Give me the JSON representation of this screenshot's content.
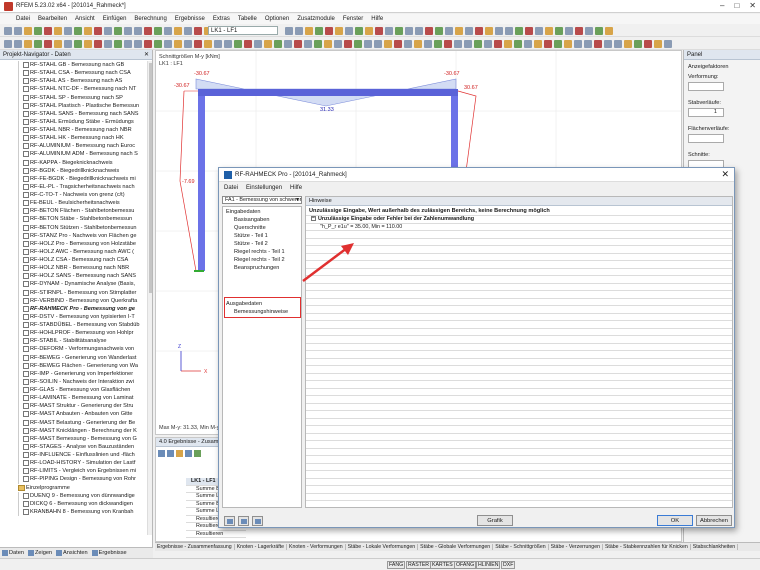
{
  "window": {
    "title": "RFEM 5.23.02 x64 - [201014_Rahmeck*]",
    "controls": [
      "–",
      "□",
      "✕"
    ]
  },
  "menu": [
    "Datei",
    "Bearbeiten",
    "Ansicht",
    "Einfügen",
    "Berechnung",
    "Ergebnisse",
    "Extras",
    "Tabelle",
    "Optionen",
    "Zusatzmodule",
    "Fenster",
    "Hilfe"
  ],
  "toolbar": {
    "load_case": "LK1 - LF1"
  },
  "navigator": {
    "title": "Projekt-Navigator - Daten",
    "items": [
      "RF-STAHL GB - Bemessung nach GB",
      "RF-STAHL CSA - Bemessung nach CSA",
      "RF-STAHL AS - Bemessung nach AS",
      "RF-STAHL NTC-DF - Bemessung nach NT",
      "RF-STAHL SP - Bemessung nach SP",
      "RF-STAHL Plastisch - Plastische Bemessun",
      "RF-STAHL SANS - Bemessung nach SANS",
      "RF-STAHL Ermüdung Stäbe - Ermüdungs",
      "RF-STAHL NBR - Bemessung nach NBR",
      "RF-STAHL HK - Bemessung nach HK",
      "RF-ALUMINIUM - Bemessung nach Euroc",
      "RF-ALUMINIUM ADM - Bemessung nach S",
      "RF-KAPPA - Biegeknicknachweis",
      "RF-BGDK - Biegedrillknicknachweis",
      "RF-FE-BGDK - Biegedrillknicknachweis mi",
      "RF-EL-PL - Tragsicherheitsnachweis nach",
      "RF-C-TO-T - Nachweis von grenz (c/t)",
      "FE-BEUL - Beulsicherheitsnachweis",
      "RF-BETON Flächen - Stahlbetonbemessu",
      "RF-BETON Stäbe - Stahlbetonbemessun",
      "RF-BETON Stützen - Stahlbetonbemessun",
      "RF-STANZ Pro - Nachweis von Flächen ge",
      "RF-HOLZ Pro - Bemessung von Holzstäbe",
      "RF-HOLZ AWC - Bemessung nach AWC (",
      "RF-HOLZ CSA - Bemessung nach CSA",
      "RF-HOLZ NBR - Bemessung nach NBR",
      "RF-HOLZ SANS - Bemessung nach SANS",
      "RF-DYNAM - Dynamische Analyse (Basis,",
      "RF-STIRNPL - Bemessung von Stirnplatter",
      "RF-VERBIND - Bemessung von Querkrafta",
      "RF-RAHMECK Pro - Bemessung von ge",
      "RF-DSTV - Bemessung von typisierten I-T",
      "RF-STABDÜBEL - Bemessung von Stabdüb",
      "RF-HOHLPROF - Bemessung von Hohlpr",
      "RF-STABIL - Stabilitätsanalyse",
      "RF-DEFORM - Verformungsnachweis von",
      "RF-BEWEG - Generierung von Wanderlast",
      "RF-BEWEG Flächen - Generierung von Wa",
      "RF-IMP - Generierung von Imperfektioner",
      "RF-SOILIN - Nachweis der Interaktion zwi",
      "RF-GLAS - Bemessung von Glasflächen",
      "RF-LAMINATE - Bemessung von Laminat",
      "RF-MAST Struktur - Generierung der Stru",
      "RF-MAST Anbauten - Anbauten von Gitte",
      "RF-MAST Belastung - Generierung der Be",
      "RF-MAST Knicklängen - Berechnung der K",
      "RF-MAST Bemessung - Bemessung von G",
      "RF-STAGES - Analyse von Bauzuständen",
      "RF-INFLUENCE - Einflusslinien und -fläch",
      "RF-LOAD-HISTORY - Simulation der Lastf",
      "RF-LIMITS - Vergleich von Ergebnissen mi",
      "RF-PIPING Design - Bemessung von Rohr"
    ],
    "category": "Einzelprogramme",
    "sub_items": [
      "DUENQ 9 - Bemessung von dünnwandige",
      "DICKQ 6 - Bemessung von dickwandigen",
      "KRANBAHN 8 - Bemessung von Kranbah"
    ],
    "tabs": [
      "Daten",
      "Zeigen",
      "Ansichten",
      "Ergebnisse"
    ]
  },
  "viewport": {
    "title": "Schnittgrößen M-y [kNm]",
    "subtitle": "LK1 : LF1",
    "values": [
      "-30.67",
      "-30.67",
      "-30.67",
      "30.67",
      "31.33",
      "-7.69"
    ],
    "footer": "Max M-y: 31.33, Min M-y:"
  },
  "right_panel": {
    "title": "Panel",
    "labels": [
      "Anzeigefaktoren",
      "Verformung:",
      "Stabverläufe:",
      "Flächenverläufe:",
      "Schnitte:"
    ],
    "stab_value": "1"
  },
  "results": {
    "title": "4.0 Ergebnisse - Zusamm",
    "lk": "LK1 - LF1",
    "rows": [
      "Summe Bela",
      "Summe Lage",
      "Summe Bela",
      "Summe Lage",
      "Resultieren",
      "Resultieren",
      "Resultieren"
    ],
    "tabs": [
      "Ergebnisse - Zusammenfassung",
      "Knoten - Lagerkräfte",
      "Knoten - Verformungen",
      "Stäbe - Lokale Verformungen",
      "Stäbe - Globale Verformungen",
      "Stäbe - Schnittgrößen",
      "Stäbe - Verzerrungen",
      "Stäbe - Stabkennzahlen für Knicken",
      "Stabschlankheiten"
    ]
  },
  "status": [
    "FANG",
    "RASTER",
    "KARTES",
    "OFANG",
    "HLINIEN",
    "DXF"
  ],
  "dialog": {
    "title": "RF-RAHMECK Pro - [201014_Rahmeck]",
    "menu": [
      "Datei",
      "Einstellungen",
      "Hilfe"
    ],
    "case_selector": "FA1 - Bemessung von schwerer",
    "tree": {
      "input_label": "Eingabedaten",
      "input_children": [
        "Basisangaben",
        "Querschnitte",
        "Stütze - Teil 1",
        "Stütze - Teil 2",
        "Riegel rechts - Teil 1",
        "Riegel rechts - Teil 2",
        "Beanspruchungen"
      ],
      "output_label": "Ausgabedaten",
      "output_children": [
        "Bemessungshinweise"
      ]
    },
    "panel_title": "Hinweise",
    "message": "Unzulässige Eingabe, Wert außerhalb des zulässigen Bereichs, keine Berechnung möglich",
    "group_header": "Unzulässige Eingabe oder Fehler bei der Zahlenumwandlung",
    "detail": "\"h_P_r e1u\" = 35.00, Min = 110.00",
    "buttons": {
      "graphic": "Grafik",
      "ok": "OK",
      "cancel": "Abbrechen"
    },
    "highlight_color": "#e03030"
  }
}
